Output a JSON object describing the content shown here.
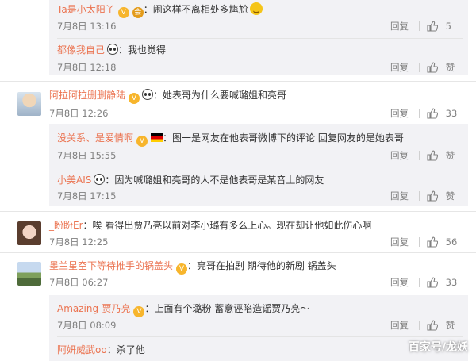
{
  "comments": [
    {
      "name": "Ta是小太阳丫",
      "text": "：闹这样不离相处多尴尬",
      "time": "7月8日 13:16",
      "reply": "回复",
      "likes": "5"
    },
    {
      "name": "都像我自己",
      "text": "：我也觉得",
      "time": "7月8日 12:18",
      "reply": "回复",
      "likes": "赞"
    },
    {
      "name": "阿拉阿拉删删静陆",
      "text": "：她表哥为什么要喊璐姐和亮哥",
      "time": "7月8日 12:26",
      "reply": "回复",
      "likes": "33"
    },
    {
      "name": "没关系、是爱情啊",
      "text": "：图一是网友在他表哥微博下的评论 回复网友的是她表哥",
      "time": "7月8日 15:55",
      "reply": "回复",
      "likes": "赞"
    },
    {
      "name": "小美AIS",
      "text": "：因为喊璐姐和亮哥的人不是他表哥是某音上的网友",
      "time": "7月8日 17:15",
      "reply": "回复",
      "likes": "赞"
    },
    {
      "name": "_盼盼Er",
      "text": "：唉 看得出贾乃亮以前对李小璐有多么上心。现在却让他如此伤心啊",
      "time": "7月8日 12:25",
      "reply": "回复",
      "likes": "56"
    },
    {
      "name": "墨兰星空下等待推手的锅盖头",
      "text": "：亮哥在拍剧 期待他的新剧 锅盖头",
      "time": "7月8日 06:27",
      "reply": "回复",
      "likes": "33"
    },
    {
      "name": "Amazing-贾乃亮",
      "text": "：上面有个璐粉 蓄意诬陷造谣贾乃亮～",
      "time": "7月8日 08:09",
      "reply": "回复",
      "likes": "赞"
    },
    {
      "name": "阿妍威武oo",
      "text": "：杀了他"
    }
  ],
  "watermark": "百家号/龙妖",
  "colors": {
    "name": "#eb7350",
    "text": "#333333",
    "meta": "#808080",
    "reply_bg": "#f2f2f5"
  }
}
